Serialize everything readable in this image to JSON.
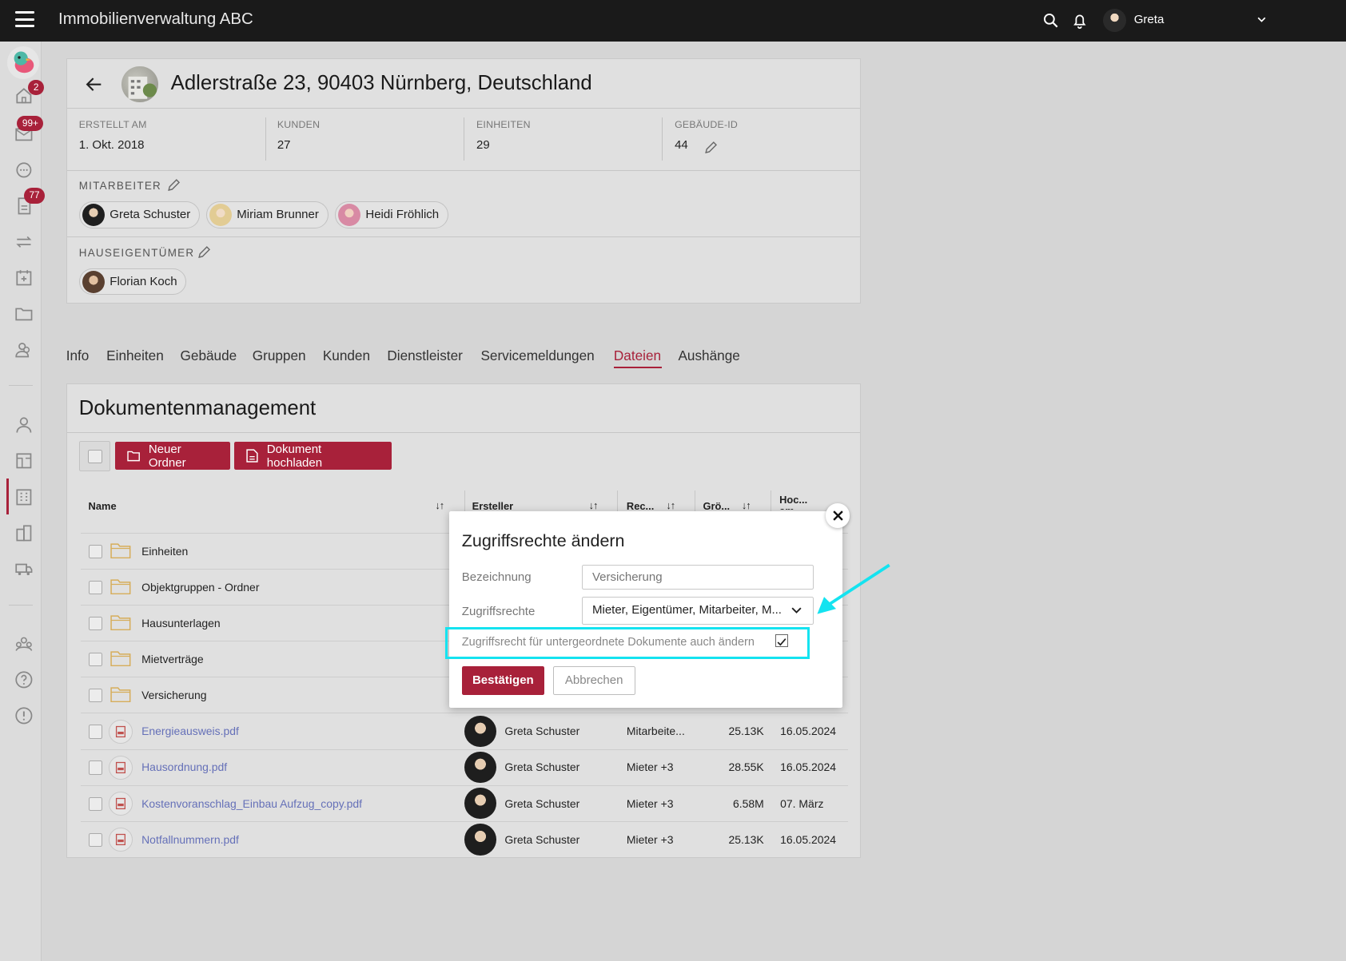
{
  "app": {
    "title": "Immobilienverwaltung ABC",
    "user_name": "Greta"
  },
  "sidebar": {
    "badges": {
      "home": "2",
      "mail": "99+",
      "documents": "77"
    },
    "items": [
      "home-icon",
      "mail-icon",
      "chat-icon",
      "document-icon",
      "transfer-icon",
      "calendar-icon",
      "folder-icon",
      "people-icon",
      "person-icon",
      "floorplan-icon",
      "building-icon",
      "buildings-icon",
      "truck-icon",
      "group-icon",
      "help-icon",
      "info-icon"
    ]
  },
  "property": {
    "title": "Adlerstraße 23, 90403 Nürnberg, Deutschland",
    "stats": [
      {
        "label": "ERSTELLT AM",
        "value": "1. Okt. 2018"
      },
      {
        "label": "KUNDEN",
        "value": "27"
      },
      {
        "label": "EINHEITEN",
        "value": "29"
      },
      {
        "label": "GEBÄUDE-ID",
        "value": "44"
      }
    ],
    "staff_label": "MITARBEITER",
    "staff": [
      "Greta Schuster",
      "Miriam Brunner",
      "Heidi Fröhlich"
    ],
    "owner_label": "HAUSEIGENTÜMER",
    "owners": [
      "Florian Koch"
    ]
  },
  "tabs": [
    "Info",
    "Einheiten",
    "Gebäude",
    "Gruppen",
    "Kunden",
    "Dienstleister",
    "Servicemeldungen",
    "Dateien",
    "Aushänge"
  ],
  "active_tab": "Dateien",
  "documents": {
    "title": "Dokumentenmanagement",
    "new_folder": "Neuer Ordner",
    "upload": "Dokument hochladen",
    "columns": {
      "name": "Name",
      "creator": "Ersteller",
      "rights": "Rec...",
      "size": "Grö...",
      "uploaded": "Hoc... am"
    },
    "folders": [
      "Einheiten",
      "Objektgruppen - Ordner",
      "Hausunterlagen",
      "Mietverträge",
      "Versicherung"
    ],
    "files": [
      {
        "name": "Energieausweis.pdf",
        "creator": "Greta Schuster",
        "rights": "Mitarbeite...",
        "size": "25.13K",
        "date": "16.05.2024"
      },
      {
        "name": "Hausordnung.pdf",
        "creator": "Greta Schuster",
        "rights": "Mieter +3",
        "size": "28.55K",
        "date": "16.05.2024"
      },
      {
        "name": "Kostenvoranschlag_Einbau Aufzug_copy.pdf",
        "creator": "Greta Schuster",
        "rights": "Mieter +3",
        "size": "6.58M",
        "date": "07. März"
      },
      {
        "name": "Notfallnummern.pdf",
        "creator": "Greta Schuster",
        "rights": "Mieter +3",
        "size": "25.13K",
        "date": "16.05.2024"
      }
    ]
  },
  "modal": {
    "title": "Zugriffsrechte ändern",
    "name_label": "Bezeichnung",
    "name_placeholder": "Versicherung",
    "rights_label": "Zugriffsrechte",
    "rights_value": "Mieter, Eigentümer, Mitarbeiter, M...",
    "checkbox_label": "Zugriffsrecht für untergeordnete Dokumente auch ändern",
    "checkbox_checked": true,
    "confirm": "Bestätigen",
    "cancel": "Abbrechen"
  },
  "colors": {
    "accent": "#a8213a",
    "highlight": "#14e3f0",
    "link": "#6570b8",
    "topbar": "#1a1a1a"
  }
}
